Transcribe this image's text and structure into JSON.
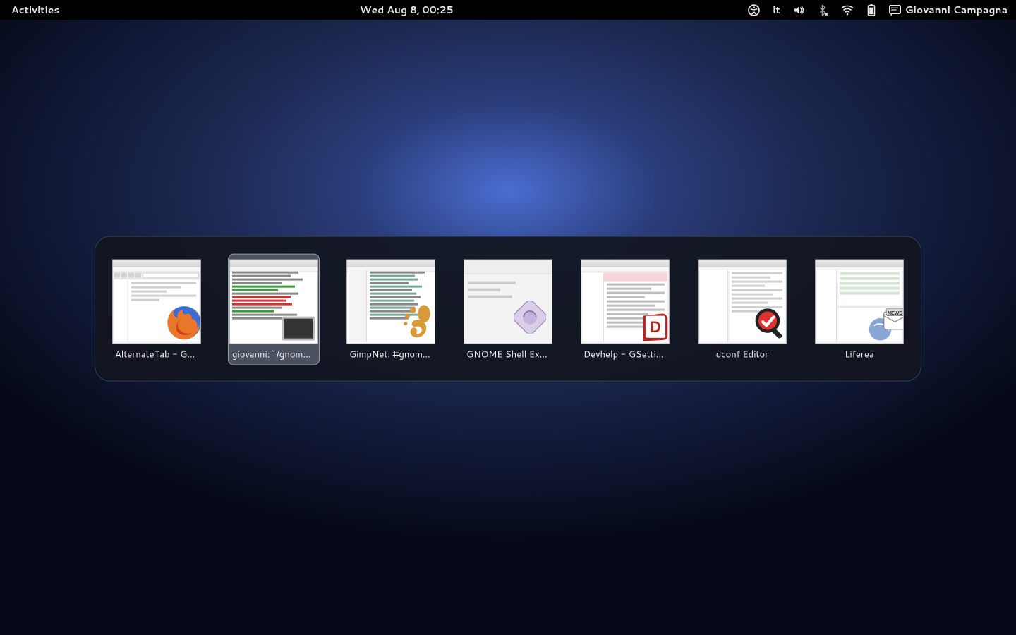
{
  "topbar": {
    "activities": "Activities",
    "clock": "Wed Aug  8, 00:25",
    "keyboard_layout": "it",
    "user_name": "Giovanni Campagna"
  },
  "switcher": {
    "selected_index": 1,
    "windows": [
      {
        "label": "AlternateTab - GNOM…",
        "app": "firefox"
      },
      {
        "label": "giovanni:~/gnome-shell…",
        "app": "terminal"
      },
      {
        "label": "GimpNet: #gnome-hac…",
        "app": "xchat"
      },
      {
        "label": "GNOME Shell Extensio…",
        "app": "webpage"
      },
      {
        "label": "Devhelp - GSettings",
        "app": "devhelp"
      },
      {
        "label": "dconf Editor",
        "app": "dconf"
      },
      {
        "label": "Liferea",
        "app": "liferea"
      }
    ]
  }
}
